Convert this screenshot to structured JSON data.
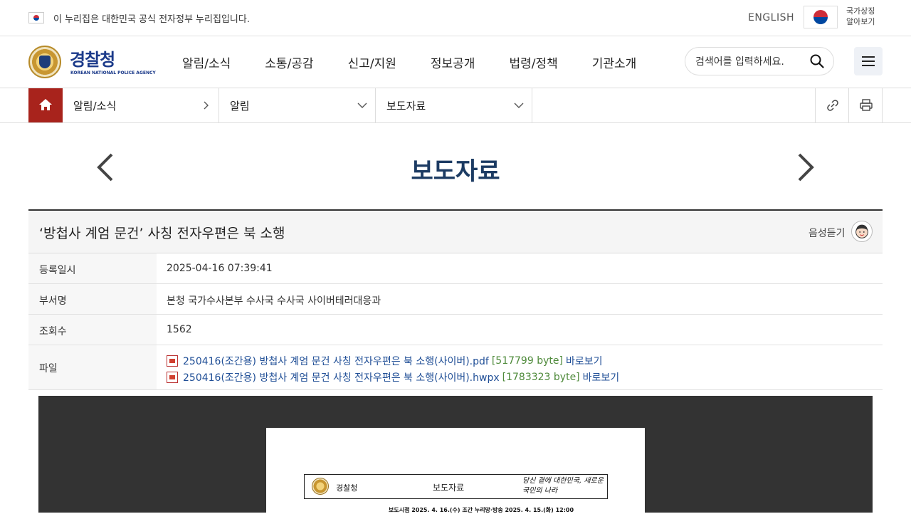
{
  "gov_bar": {
    "notice": "이 누리집은 대한민국 공식 전자정부 누리집입니다.",
    "english_link": "ENGLISH",
    "symbol_label": "국가상징 알아보기"
  },
  "header": {
    "logo_title": "경찰청",
    "logo_subtitle": "KOREAN NATIONAL POLICE AGENCY",
    "nav": [
      "알림/소식",
      "소통/공감",
      "신고/지원",
      "정보공개",
      "법령/정책",
      "기관소개"
    ],
    "search_placeholder": "검색어를 입력하세요."
  },
  "breadcrumb": {
    "items": [
      "알림/소식",
      "알림",
      "보도자료"
    ]
  },
  "page": {
    "title": "보도자료"
  },
  "article": {
    "title": "‘방첩사 계엄 문건’ 사칭 전자우편은 북 소행",
    "voice_label": "음성듣기",
    "fields": [
      {
        "label": "등록일시",
        "value": "2025-04-16 07:39:41"
      },
      {
        "label": "부서명",
        "value": "본청 국가수사본부 수사국 수사국 사이버테러대응과"
      },
      {
        "label": "조회수",
        "value": "1562"
      }
    ],
    "file_label": "파일",
    "files": [
      {
        "type": "pdf",
        "name": "250416(조간용) 방첩사 계엄 문건 사칭 전자우편은 북 소행(사이버).pdf",
        "size": "[517799 byte]",
        "view": "바로보기"
      },
      {
        "type": "hwpx",
        "name": "250416(조간용) 방첩사 계엄 문건 사칭 전자우편은 북 소행(사이버).hwpx",
        "size": "[1783323 byte]",
        "view": "바로보기"
      }
    ]
  },
  "document_preview": {
    "agency": "경찰청",
    "type": "보도자료",
    "slogan": "당신 곁에 대한민국, 새로운 국민의 나라",
    "embargo": "보도시점  2025. 4. 16.(수) 조간  누리망·방송  2025. 4. 15.(화) 12:00"
  },
  "colors": {
    "home_button": "#a8231c",
    "title": "#1c3b63",
    "link": "#1f4e96",
    "file_size": "#4e8a3a",
    "viewer_bg": "#333333"
  }
}
